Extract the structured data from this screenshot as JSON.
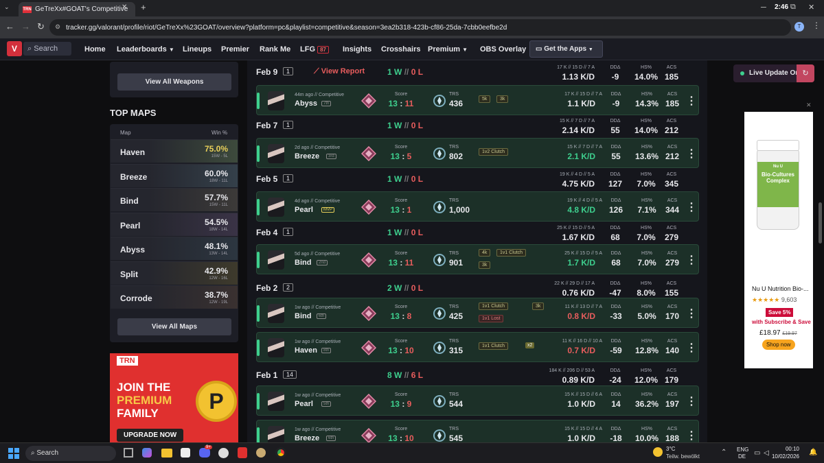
{
  "browser": {
    "tab_title": "GeTreXx#GOAT's Competitive",
    "tab_favicon": "TRN",
    "url": "tracker.gg/valorant/profile/riot/GeTreXx%23GOAT/overview?platform=pc&playlist=competitive&season=3ea2b318-423b-cf86-25da-7cbb0eefbe2d",
    "clock": "2:46",
    "avatar_letter": "T"
  },
  "nav": {
    "search": "Search",
    "items": [
      "Home",
      "Leaderboards",
      "Lineups",
      "Premier",
      "Rank Me",
      "LFG",
      "Insights",
      "Crosshairs",
      "Premium",
      "OBS Overlay"
    ],
    "lfg_count": "87",
    "get_apps": "Get the Apps"
  },
  "left": {
    "view_weapons": "View All Weapons",
    "top_maps_title": "TOP MAPS",
    "col_map": "Map",
    "col_win": "Win %",
    "maps": [
      {
        "name": "Haven",
        "pct": "75.0%",
        "rec": "15W - 5L"
      },
      {
        "name": "Breeze",
        "pct": "60.0%",
        "rec": "18W - 11L"
      },
      {
        "name": "Bind",
        "pct": "57.7%",
        "rec": "15W - 11L"
      },
      {
        "name": "Pearl",
        "pct": "54.5%",
        "rec": "18W - 14L"
      },
      {
        "name": "Abyss",
        "pct": "48.1%",
        "rec": "13W - 14L"
      },
      {
        "name": "Split",
        "pct": "42.9%",
        "rec": "12W - 16L"
      },
      {
        "name": "Corrode",
        "pct": "38.7%",
        "rec": "12W - 19L"
      }
    ],
    "view_maps": "View All Maps",
    "ad": {
      "brand": "TRN",
      "line1": "JOIN THE",
      "line2": "PREMIUM",
      "line3": "FAMILY",
      "cta": "UPGRADE NOW"
    }
  },
  "labels": {
    "score": "Score",
    "trs": "TRS",
    "dda": "DDΔ",
    "hs": "HS%",
    "acs": "ACS",
    "sep": "//",
    "colon": ":",
    "x2": "x2"
  },
  "days": [
    {
      "date": "Feb 9",
      "count": "1",
      "w": "1 W",
      "l": "0 L",
      "report": "View Report",
      "kda": "17 K // 15 D // 7 A",
      "kd": "1.13 K/D",
      "dda": "-9",
      "hs": "14.0%",
      "acs": "185"
    },
    {
      "date": "Feb 7",
      "count": "1",
      "w": "1 W",
      "l": "0 L",
      "kda": "15 K // 7 D // 7 A",
      "kd": "2.14 K/D",
      "dda": "55",
      "hs": "14.0%",
      "acs": "212"
    },
    {
      "date": "Feb 5",
      "count": "1",
      "w": "1 W",
      "l": "0 L",
      "kda": "19 K // 4 D // 5 A",
      "kd": "4.75 K/D",
      "dda": "127",
      "hs": "7.0%",
      "acs": "345"
    },
    {
      "date": "Feb 4",
      "count": "1",
      "w": "1 W",
      "l": "0 L",
      "kda": "25 K // 15 D // 5 A",
      "kd": "1.67 K/D",
      "dda": "68",
      "hs": "7.0%",
      "acs": "279"
    },
    {
      "date": "Feb 2",
      "count": "2",
      "w": "2 W",
      "l": "0 L",
      "kda": "22 K // 29 D // 17 A",
      "kd": "0.76 K/D",
      "dda": "-47",
      "hs": "8.0%",
      "acs": "155"
    },
    {
      "date": "Feb 1",
      "count": "14",
      "w": "8 W",
      "l": "6 L",
      "kda": "184 K // 206 D // 53 A",
      "kd": "0.89 K/D",
      "dda": "-24",
      "hs": "12.0%",
      "acs": "179"
    }
  ],
  "matches": [
    {
      "ago": "44m ago // Competitive",
      "map": "Abyss",
      "place": "7th",
      "s1": "13",
      "s2": "11",
      "trs": "436",
      "badges": [
        "5k",
        "3k"
      ],
      "kda": "17 K // 15 D // 7 A",
      "kd": "1.1 K/D",
      "dda": "-9",
      "hs": "14.3%",
      "acs": "185"
    },
    {
      "ago": "2d ago // Competitive",
      "map": "Breeze",
      "place": "3rd",
      "s1": "13",
      "s2": "5",
      "trs": "802",
      "badges": [
        "1v2 Clutch"
      ],
      "kda": "15 K // 7 D // 7 A",
      "kd": "2.1 K/D",
      "dda": "55",
      "hs": "13.6%",
      "acs": "212"
    },
    {
      "ago": "4d ago // Competitive",
      "map": "Pearl",
      "place": "MVP",
      "s1": "13",
      "s2": "1",
      "trs": "1,000",
      "badges": [],
      "kda": "19 K // 4 D // 5 A",
      "kd": "4.8 K/D",
      "dda": "126",
      "hs": "7.1%",
      "acs": "344"
    },
    {
      "ago": "5d ago // Competitive",
      "map": "Bind",
      "place": "2nd",
      "s1": "13",
      "s2": "11",
      "trs": "901",
      "badges": [
        "4k",
        "1v1 Clutch",
        "3k"
      ],
      "kda": "25 K // 15 D // 5 A",
      "kd": "1.7 K/D",
      "dda": "68",
      "hs": "7.0%",
      "acs": "279"
    },
    {
      "ago": "1w ago // Competitive",
      "map": "Bind",
      "place": "6th",
      "s1": "13",
      "s2": "8",
      "trs": "425",
      "badges": [
        "1v1 Clutch",
        "3k",
        "1v1 Lost"
      ],
      "kda": "11 K // 13 D // 7 A",
      "kd": "0.8 K/D",
      "dda": "-33",
      "hs": "5.0%",
      "acs": "170"
    },
    {
      "ago": "1w ago // Competitive",
      "map": "Haven",
      "place": "8th",
      "s1": "13",
      "s2": "10",
      "trs": "315",
      "badges": [
        "1v1 Clutch"
      ],
      "kda": "11 K // 16 D // 10 A",
      "kd": "0.7 K/D",
      "dda": "-59",
      "hs": "12.8%",
      "acs": "140"
    },
    {
      "ago": "1w ago // Competitive",
      "map": "Pearl",
      "place": "5th",
      "s1": "13",
      "s2": "9",
      "trs": "544",
      "badges": [],
      "kda": "15 K // 15 D // 6 A",
      "kd": "1.0 K/D",
      "dda": "14",
      "hs": "36.2%",
      "acs": "197"
    },
    {
      "ago": "1w ago // Competitive",
      "map": "Breeze",
      "place": "6th",
      "s1": "13",
      "s2": "10",
      "trs": "545",
      "badges": [],
      "kda": "15 K // 15 D // 4 A",
      "kd": "1.0 K/D",
      "dda": "-18",
      "hs": "10.0%",
      "acs": "188"
    }
  ],
  "right": {
    "live": "Live Update On",
    "ad_brand": "Nu U",
    "ad_prod1": "Bio-Cultures",
    "ad_prod2": "Complex",
    "ad_title": "Nu U Nutrition Bio-...",
    "ad_stars": "★★★★★",
    "ad_reviews": "9,603",
    "ad_save": "Save 5%",
    "ad_sub": "with Subscribe & Save",
    "ad_price": "£18.97",
    "ad_old": "£19.97",
    "ad_shop": "Shop now",
    "close": "✕"
  },
  "taskbar": {
    "search": "Search",
    "temp": "3°C",
    "weather": "Teilw. bewölkt",
    "lang1": "ENG",
    "lang2": "DE",
    "time": "00:10",
    "date": "10/02/2026",
    "notif": "9+"
  }
}
